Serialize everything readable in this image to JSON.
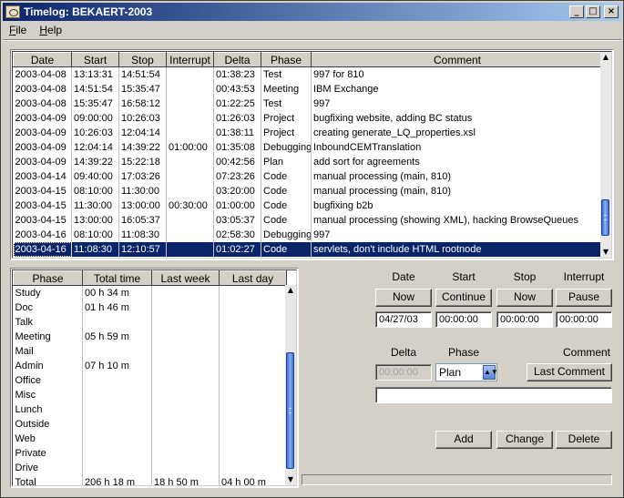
{
  "window": {
    "title": "Timelog: BEKAERT-2003"
  },
  "menu": [
    "File",
    "Help"
  ],
  "log_table": {
    "columns": [
      "Date",
      "Start",
      "Stop",
      "Interrupt",
      "Delta",
      "Phase",
      "Comment"
    ],
    "rows": [
      [
        "2003-04-08",
        "13:13:31",
        "14:51:54",
        "",
        "01:38:23",
        "Test",
        "997 for 810"
      ],
      [
        "2003-04-08",
        "14:51:54",
        "15:35:47",
        "",
        "00:43:53",
        "Meeting",
        "IBM Exchange"
      ],
      [
        "2003-04-08",
        "15:35:47",
        "16:58:12",
        "",
        "01:22:25",
        "Test",
        "997"
      ],
      [
        "2003-04-09",
        "09:00:00",
        "10:26:03",
        "",
        "01:26:03",
        "Project",
        "bugfixing website, adding BC status"
      ],
      [
        "2003-04-09",
        "10:26:03",
        "12:04:14",
        "",
        "01:38:11",
        "Project",
        "creating generate_LQ_properties.xsl"
      ],
      [
        "2003-04-09",
        "12:04:14",
        "14:39:22",
        "01:00:00",
        "01:35:08",
        "Debugging",
        "InboundCEMTranslation"
      ],
      [
        "2003-04-09",
        "14:39:22",
        "15:22:18",
        "",
        "00:42:56",
        "Plan",
        "add sort for agreements"
      ],
      [
        "2003-04-14",
        "09:40:00",
        "17:03:26",
        "",
        "07:23:26",
        "Code",
        "manual processing (main, 810)"
      ],
      [
        "2003-04-15",
        "08:10:00",
        "11:30:00",
        "",
        "03:20:00",
        "Code",
        "manual processing (main, 810)"
      ],
      [
        "2003-04-15",
        "11:30:00",
        "13:00:00",
        "00:30:00",
        "01:00:00",
        "Code",
        "bugfixing b2b"
      ],
      [
        "2003-04-15",
        "13:00:00",
        "16:05:37",
        "",
        "03:05:37",
        "Code",
        "manual processing (showing XML), hacking BrowseQueues"
      ],
      [
        "2003-04-16",
        "08:10:00",
        "11:08:30",
        "",
        "02:58:30",
        "Debugging",
        "997"
      ],
      [
        "2003-04-16",
        "11:08:30",
        "12:10:57",
        "",
        "01:02:27",
        "Code",
        "servlets, don't include HTML rootnode"
      ]
    ],
    "selected_row": 12
  },
  "summary_table": {
    "columns": [
      "Phase",
      "Total time",
      "Last week",
      "Last day"
    ],
    "rows": [
      [
        "Study",
        "00 h 34 m",
        "",
        ""
      ],
      [
        "Doc",
        "01 h 46 m",
        "",
        ""
      ],
      [
        "Talk",
        "",
        "",
        ""
      ],
      [
        "Meeting",
        "05 h 59 m",
        "",
        ""
      ],
      [
        "Mail",
        "",
        "",
        ""
      ],
      [
        "Admin",
        "07 h 10 m",
        "",
        ""
      ],
      [
        "Office",
        "",
        "",
        ""
      ],
      [
        "Misc",
        "",
        "",
        ""
      ],
      [
        "Lunch",
        "",
        "",
        ""
      ],
      [
        "Outside",
        "",
        "",
        ""
      ],
      [
        "Web",
        "",
        "",
        ""
      ],
      [
        "Private",
        "",
        "",
        ""
      ],
      [
        "Drive",
        "",
        "",
        ""
      ],
      [
        "Total",
        "206 h 18 m",
        "18 h 50 m",
        "04 h 00 m"
      ]
    ]
  },
  "editor": {
    "labels": {
      "date": "Date",
      "start": "Start",
      "stop": "Stop",
      "interrupt": "Interrupt",
      "delta": "Delta",
      "phase": "Phase",
      "comment": "Comment"
    },
    "buttons": {
      "now_date": "Now",
      "continue": "Continue",
      "now_stop": "Now",
      "pause": "Pause",
      "last_comment": "Last Comment",
      "add": "Add",
      "change": "Change",
      "delete": "Delete"
    },
    "values": {
      "date": "04/27/03",
      "start": "00:00:00",
      "stop": "00:00:00",
      "interrupt": "00:00:00",
      "delta": "00:00:00",
      "phase": "Plan",
      "comment": ""
    }
  }
}
